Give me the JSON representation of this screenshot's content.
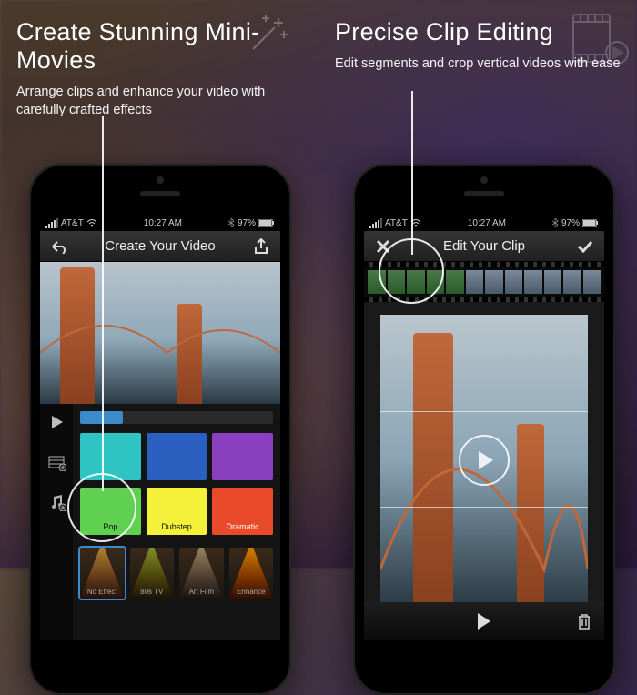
{
  "panel_left": {
    "headline": "Create Stunning Mini-Movies",
    "sub": "Arrange clips and enhance your video with carefully crafted effects"
  },
  "panel_right": {
    "headline": "Precise Clip Editing",
    "sub": "Edit segments and crop vertical videos with ease"
  },
  "statusbar": {
    "carrier": "AT&T",
    "time": "10:27 AM",
    "battery": "97%"
  },
  "screen_left": {
    "nav_title": "Create Your Video",
    "music_labels": [
      "Pop",
      "Dubstep",
      "Dramatic"
    ],
    "effects": [
      "No Effect",
      "80s TV",
      "Art Film",
      "Enhance"
    ]
  },
  "screen_right": {
    "nav_title": "Edit Your Clip"
  },
  "icons": {
    "wifi": "wifi",
    "bluetooth": "bt"
  }
}
